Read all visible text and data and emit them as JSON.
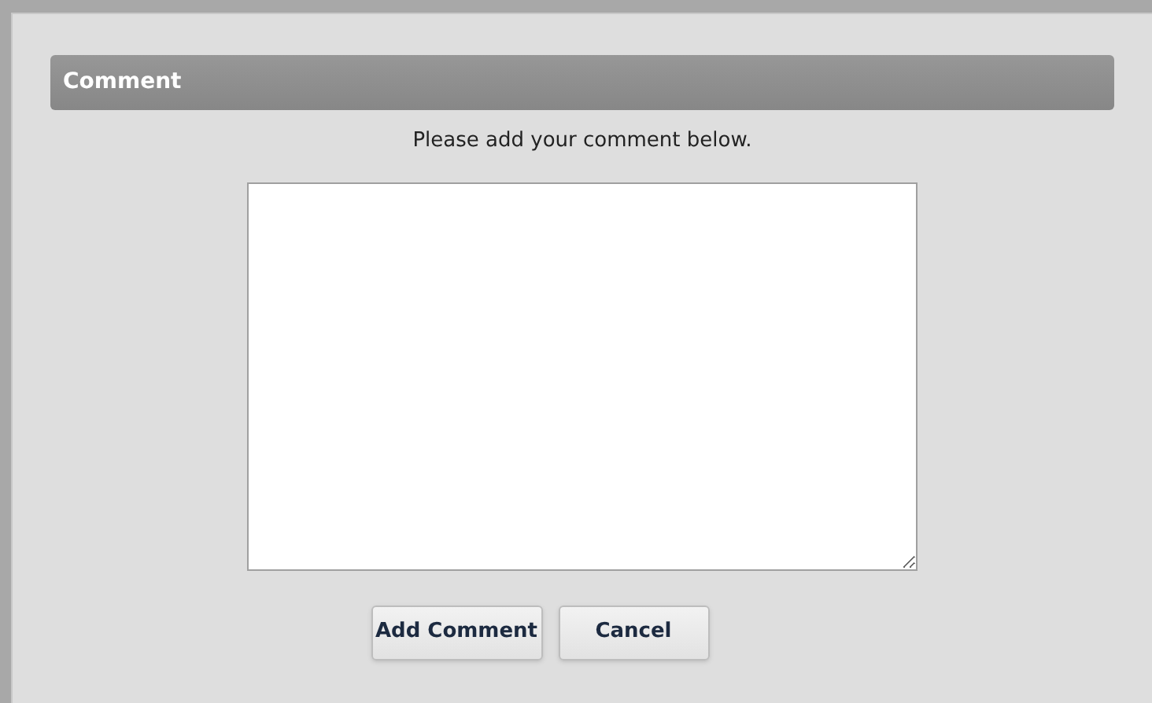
{
  "dialog": {
    "title": "Comment",
    "instruction": "Please add your comment below.",
    "buttons": [
      {
        "label": "Add Comment"
      },
      {
        "label": "Cancel"
      }
    ]
  }
}
